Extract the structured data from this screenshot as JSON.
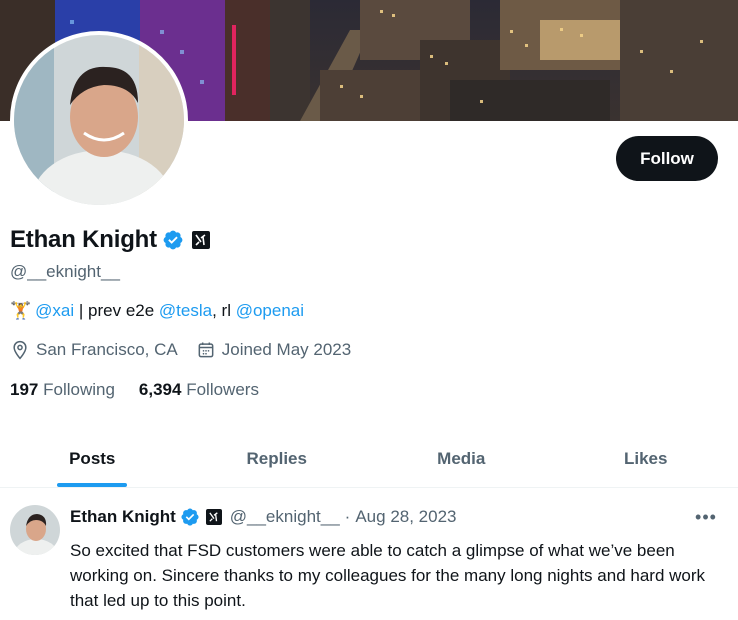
{
  "profile": {
    "display_name": "Ethan Knight",
    "handle": "@__eknight__",
    "follow_label": "Follow",
    "bio": {
      "emoji": "🏋️",
      "link1": "@xai",
      "sep": " | prev e2e ",
      "link2": "@tesla",
      "mid": ", rl ",
      "link3": "@openai"
    },
    "location": "San Francisco, CA",
    "joined": "Joined May 2023",
    "following_count": "197",
    "following_label": "Following",
    "followers_count": "6,394",
    "followers_label": "Followers",
    "affiliation_icon": "x-ai-logo-icon",
    "verified_color": "#1d9bf0"
  },
  "tabs": [
    {
      "label": "Posts",
      "active": true
    },
    {
      "label": "Replies",
      "active": false
    },
    {
      "label": "Media",
      "active": false
    },
    {
      "label": "Likes",
      "active": false
    }
  ],
  "tweet": {
    "name": "Ethan Knight",
    "handle": "@__eknight__",
    "dot": "·",
    "date": "Aug 28, 2023",
    "more": "•••",
    "text": "So excited that FSD customers were able to catch a glimpse of what we’ve been working on. Sincere thanks to my colleagues for the many long nights and hard work that led up to this point."
  },
  "colors": {
    "accent": "#1d9bf0",
    "text_primary": "#0f1419",
    "text_secondary": "#536471"
  }
}
